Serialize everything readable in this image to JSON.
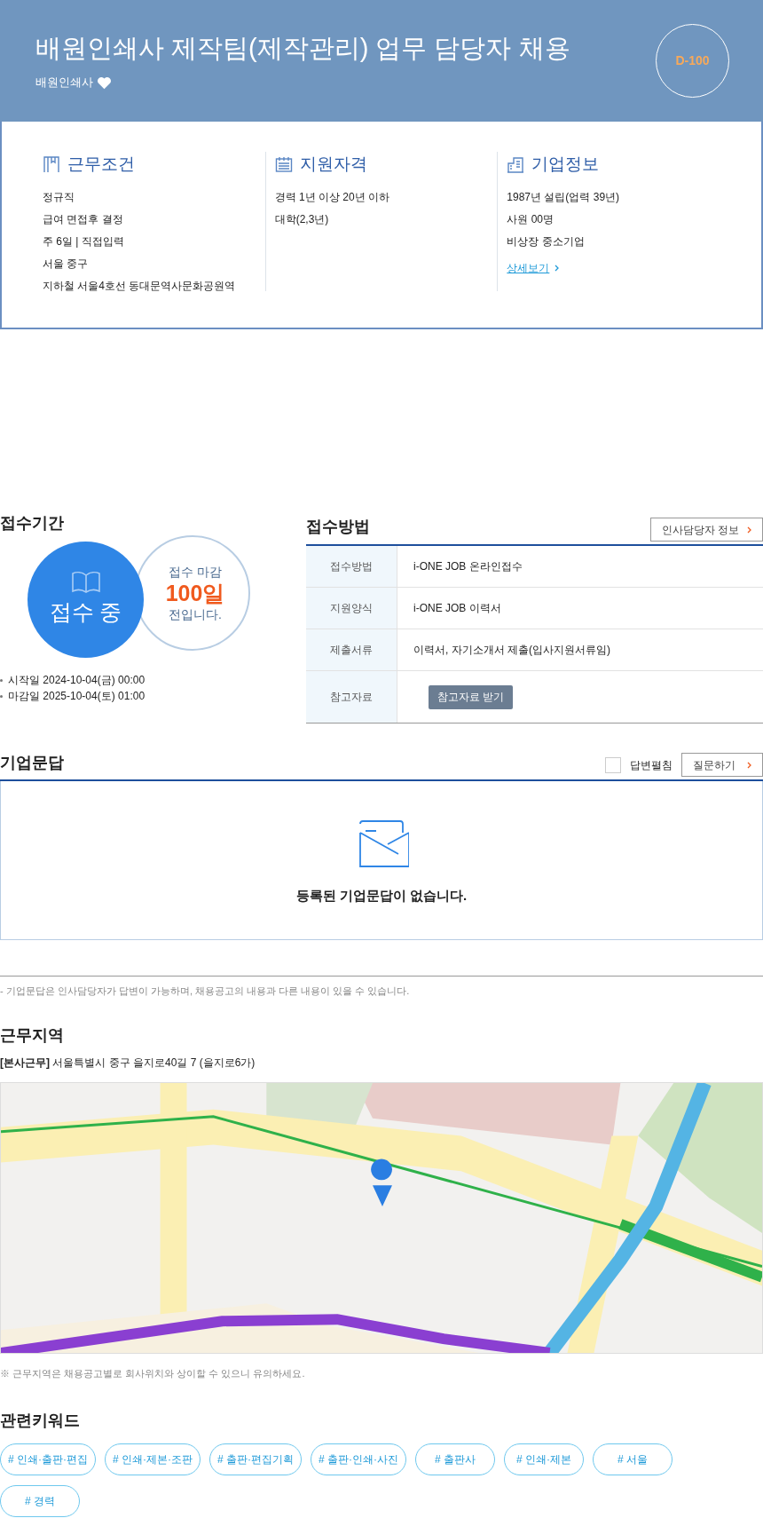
{
  "header": {
    "title": "배원인쇄사 제작팀(제작관리) 업무 담당자 채용",
    "company": "배원인쇄사",
    "d_day": "D-100"
  },
  "info_columns": [
    {
      "kind": "work",
      "title": "근무조건",
      "items": [
        "정규직",
        "급여 면접후 결정",
        "주 6일 | 직접입력",
        "서울 중구",
        "지하철 서울4호선 동대문역사문화공원역"
      ]
    },
    {
      "kind": "qualification",
      "title": "지원자격",
      "items": [
        "경력 1년 이상 20년 이하",
        "대학(2,3년)"
      ]
    },
    {
      "kind": "company",
      "title": "기업정보",
      "items": [
        "1987년 설립(업력 39년)",
        "사원 00명",
        "비상장 중소기업"
      ],
      "link": "상세보기"
    }
  ],
  "reception": {
    "title": "접수기간",
    "status": "접수 중",
    "countdown": [
      "접수 마감",
      "100일",
      "전입니다."
    ],
    "dates": [
      "시작일 2024-10-04(금) 00:00",
      "마감일 2025-10-04(토) 01:00"
    ]
  },
  "method": {
    "title": "접수방법",
    "contact_button": "인사담당자 정보",
    "rows": [
      {
        "kind": "text",
        "label": "접수방법",
        "value": "i-ONE JOB 온라인접수"
      },
      {
        "kind": "text",
        "label": "지원양식",
        "value": "i-ONE JOB 이력서"
      },
      {
        "kind": "text",
        "label": "제출서류",
        "value": "이력서, 자기소개서 제출(입사지원서류임)"
      },
      {
        "kind": "button",
        "label": "참고자료",
        "value": "참고자료 받기"
      }
    ]
  },
  "qna": {
    "title": "기업문답",
    "toggle": {
      "label": "답변펼침",
      "checked": false
    },
    "ask_button": "질문하기",
    "empty_message": "등록된 기업문답이 없습니다.",
    "note": "- 기업문답은 인사담당자가 답변이 가능하며, 채용공고의 내용과 다른 내용이 있을 수 있습니다."
  },
  "location": {
    "title": "근무지역",
    "address_tag": "[본사근무]",
    "address": "서울특별시 중구 을지로40길 7 (을지로6가)",
    "note": "※ 근무지역은 채용공고별로 회사위치와 상이할 수 있으니 유의하세요."
  },
  "keywords": {
    "title": "관련키워드",
    "tags": [
      "# 인쇄·출판·편집",
      "# 인쇄·제본·조판",
      "# 출판·편집기획",
      "# 출판·인쇄·사진",
      "# 출판사",
      "# 인쇄·제본",
      "# 서울",
      "# 경력"
    ]
  }
}
